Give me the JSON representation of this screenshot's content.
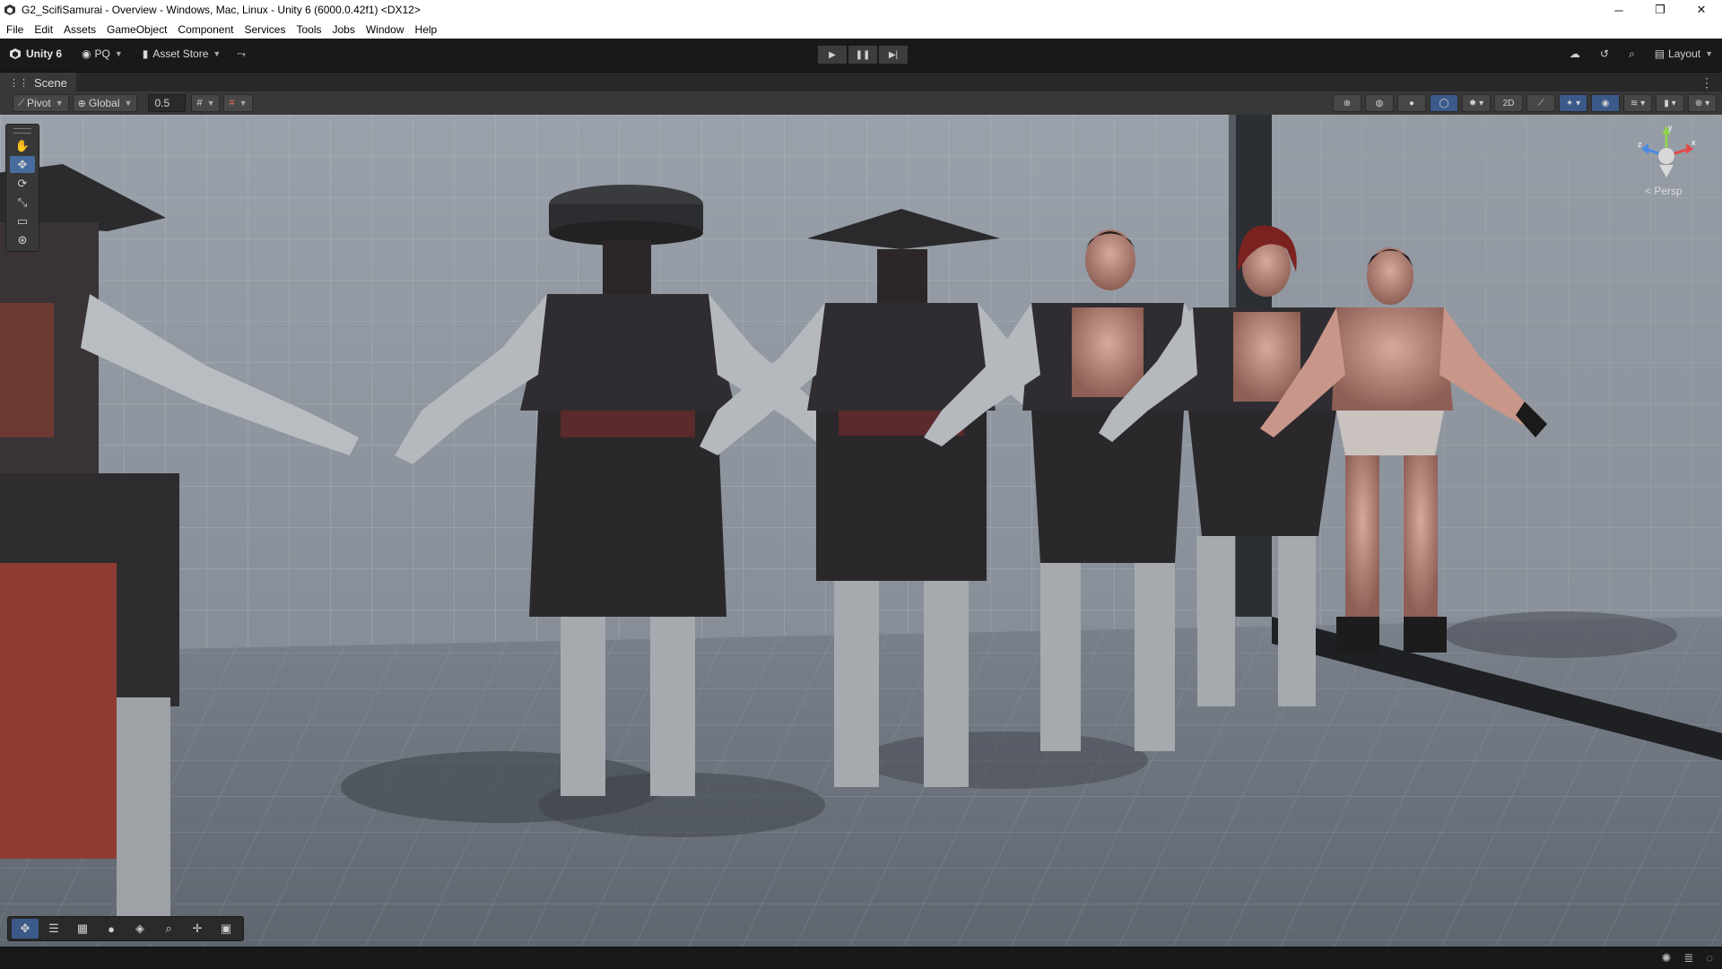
{
  "window": {
    "title": "G2_ScifiSamurai - Overview - Windows, Mac, Linux - Unity 6 (6000.0.42f1) <DX12>",
    "controls": [
      "─",
      "❐",
      "✕"
    ]
  },
  "menu": [
    "File",
    "Edit",
    "Assets",
    "GameObject",
    "Component",
    "Services",
    "Tools",
    "Jobs",
    "Window",
    "Help"
  ],
  "toolbar": {
    "unity_label": "Unity 6",
    "account_label": "PQ",
    "asset_store_label": "Asset Store",
    "play_icons": [
      "▶",
      "❚❚",
      "▶|"
    ],
    "layout_label": "Layout"
  },
  "tab": {
    "label": "Scene"
  },
  "scene_toolbar": {
    "pivot_label": "Pivot",
    "global_label": "Global",
    "snap_value": "0.5",
    "two_d_label": "2D"
  },
  "gizmo": {
    "y": "y",
    "z": "z",
    "x": "x",
    "persp_label": "< Persp"
  },
  "scene": {
    "floor_color": "#6e7580",
    "wall_color": "#8a919b",
    "characters": [
      {
        "headwear": "conical-hat",
        "armor": "full"
      },
      {
        "headwear": "disc-helmet",
        "armor": "full"
      },
      {
        "headwear": "conical-hat",
        "armor": "full"
      },
      {
        "headwear": "none",
        "armor": "partial"
      },
      {
        "headwear": "red-hair",
        "armor": "partial"
      },
      {
        "headwear": "none",
        "armor": "none"
      }
    ]
  }
}
